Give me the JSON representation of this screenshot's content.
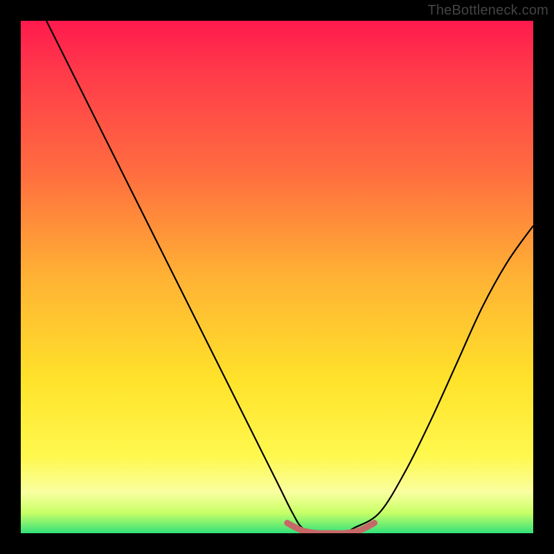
{
  "watermark": "TheBottleneck.com",
  "chart_data": {
    "type": "line",
    "title": "",
    "xlabel": "",
    "ylabel": "",
    "xlim": [
      0,
      100
    ],
    "ylim": [
      0,
      100
    ],
    "series": [
      {
        "name": "bottleneck-curve",
        "x": [
          5,
          10,
          15,
          20,
          25,
          30,
          35,
          40,
          45,
          50,
          53,
          55,
          58,
          60,
          63,
          65,
          70,
          75,
          80,
          85,
          90,
          95,
          100
        ],
        "y": [
          100,
          90,
          80,
          70,
          60,
          50,
          40,
          30,
          20,
          10,
          4,
          1,
          0,
          0,
          0,
          1,
          4,
          12,
          22,
          33,
          44,
          53,
          60
        ]
      },
      {
        "name": "flat-bottom-highlight",
        "x": [
          52,
          55,
          58,
          60,
          63,
          66,
          69
        ],
        "y": [
          2,
          0.5,
          0,
          0,
          0,
          0.5,
          2
        ]
      }
    ],
    "gradient_stops": [
      {
        "pos": 0.0,
        "color": "#ff1a4d"
      },
      {
        "pos": 0.5,
        "color": "#ffb234"
      },
      {
        "pos": 0.85,
        "color": "#fff84e"
      },
      {
        "pos": 1.0,
        "color": "#33e27a"
      }
    ],
    "highlight_color": "#c76868",
    "curve_color": "#000000"
  }
}
